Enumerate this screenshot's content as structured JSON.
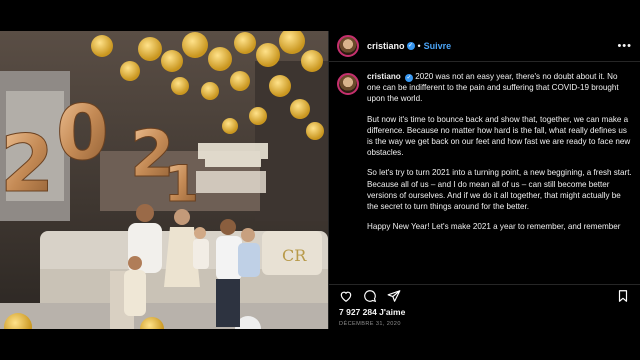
{
  "post": {
    "username": "cristiano",
    "verified_mark": "✓",
    "separator": "•",
    "follow_label": "Suivre",
    "more_label": "•••",
    "caption": [
      "2020 was not an easy year, there's no doubt about it. No one can be indifferent to the pain and suffering that COVID-19 brought upon the world.",
      "But now it's time to bounce back and show that, together, we can make a difference. Because no matter how hard is the fall, what really defines us is the way we get back on our feet and how fast we are ready to face new obstacles.",
      "So let's try to turn 2021 into a turning point, a new beggining, a fresh start. Because all of us – and I do mean all of us – can still become better versions of ourselves. And if we do it all together, that might actually be the secret to turn things around for the better.",
      "Happy New Year! Let's make 2021 a year to remember, and remember"
    ],
    "likes": "7 927 284 J'aime",
    "date": "DÉCEMBRE 31, 2020"
  },
  "photo": {
    "balloon_numbers": [
      "2",
      "0",
      "2",
      "1"
    ],
    "pillow_monogram": "CR"
  },
  "icons": [
    "heart-icon",
    "comment-icon",
    "share-icon",
    "bookmark-icon",
    "verified-icon",
    "more-icon"
  ]
}
